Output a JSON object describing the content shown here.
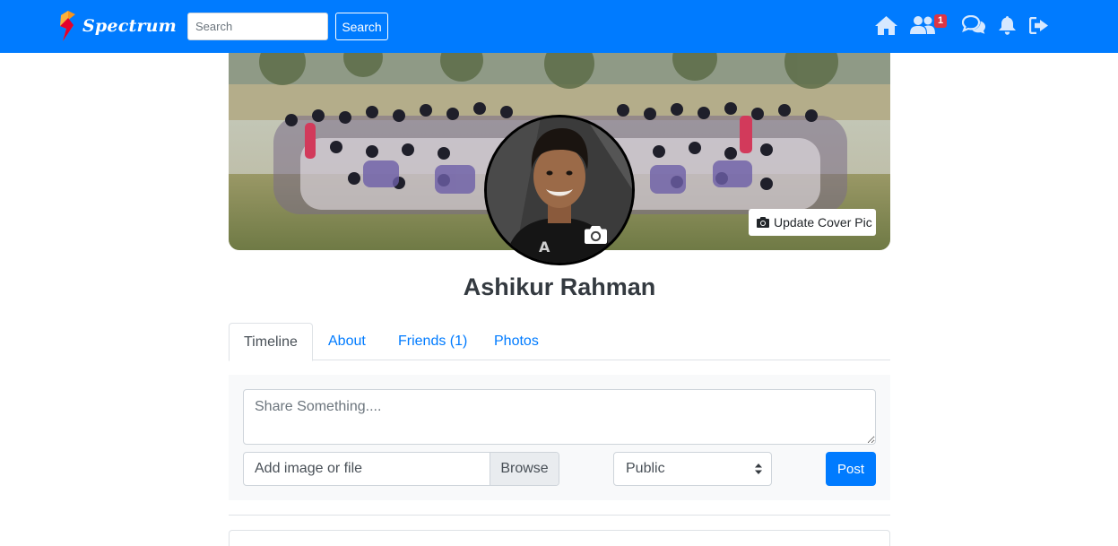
{
  "navbar": {
    "brand": "Spectrum",
    "search_placeholder": "Search",
    "search_button": "Search",
    "icons": [
      "home-icon",
      "friends-icon",
      "messages-icon",
      "bell-icon",
      "logout-icon"
    ],
    "friend_requests_badge": "1",
    "color": "#007bff"
  },
  "profile": {
    "name": "Ashikur Rahman",
    "update_cover_label": "Update Cover Pic"
  },
  "tabs": [
    {
      "label": "Timeline",
      "active": true
    },
    {
      "label": "About",
      "active": false
    },
    {
      "label": "Friends (1)",
      "active": false
    },
    {
      "label": "Photos",
      "active": false
    }
  ],
  "composer": {
    "placeholder": "Share Something....",
    "file_label": "Add image or file",
    "browse_label": "Browse",
    "privacy_value": "Public",
    "post_button": "Post"
  }
}
